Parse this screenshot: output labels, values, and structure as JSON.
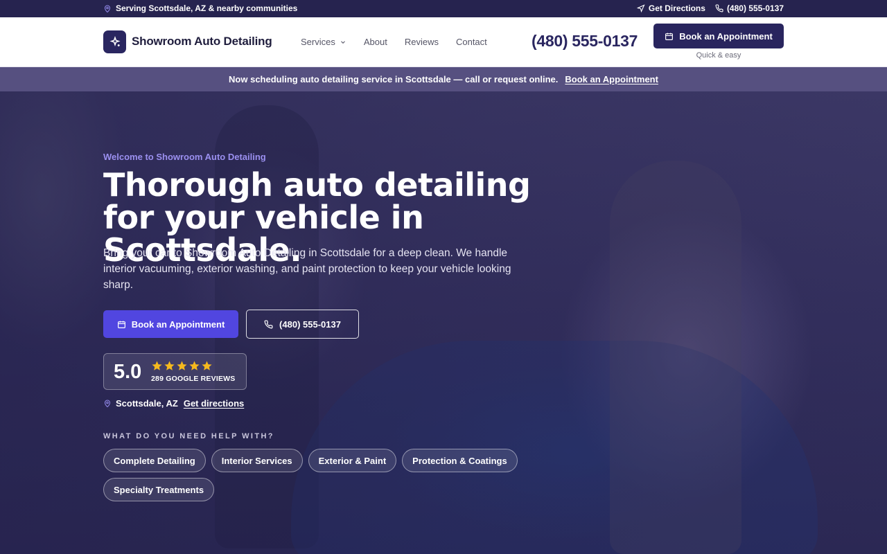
{
  "topbar": {
    "service_area": "Serving Scottsdale, AZ & nearby communities",
    "directions_label": "Get Directions",
    "phone": "(480) 555-0137"
  },
  "header": {
    "brand": "Showroom Auto Detailing",
    "nav": [
      {
        "label": "Services",
        "has_dropdown": true
      },
      {
        "label": "About"
      },
      {
        "label": "Reviews"
      },
      {
        "label": "Contact"
      }
    ],
    "phone": "(480) 555-0137",
    "cta_label": "Book an Appointment",
    "cta_sub": "Quick & easy"
  },
  "announcement": {
    "message": "Now scheduling auto detailing service in Scottsdale — call or request online.",
    "link_label": "Book an Appointment"
  },
  "hero": {
    "eyebrow": "Welcome to Showroom Auto Detailing",
    "title": "Thorough auto detailing for your vehicle in Scottsdale.",
    "description": "Bring your car to Showroom Auto Detailing in Scottsdale for a deep clean. We handle interior vacuuming, exterior washing, and paint protection to keep your vehicle looking sharp.",
    "primary_cta": "Book an Appointment",
    "phone_cta": "(480) 555-0137",
    "rating": {
      "score": "5.0",
      "stars": 5,
      "count_label": "289 GOOGLE REVIEWS"
    },
    "location": {
      "city": "Scottsdale, AZ",
      "link_label": "Get directions"
    },
    "help_heading": "WHAT DO YOU NEED HELP WITH?",
    "chips": [
      "Complete Detailing",
      "Interior Services",
      "Exterior & Paint",
      "Protection & Coatings",
      "Specialty Treatments"
    ]
  },
  "colors": {
    "brand_dark": "#29255e",
    "accent": "#5146e0",
    "eyebrow": "#9b90f0",
    "star": "#f5b91e"
  },
  "icons": {
    "location": "map-pin-icon",
    "directions": "navigation-arrow-icon",
    "phone": "phone-icon",
    "calendar": "calendar-icon",
    "logo": "sparkle-icon",
    "dropdown": "chevron-down-icon",
    "star": "star-icon"
  }
}
